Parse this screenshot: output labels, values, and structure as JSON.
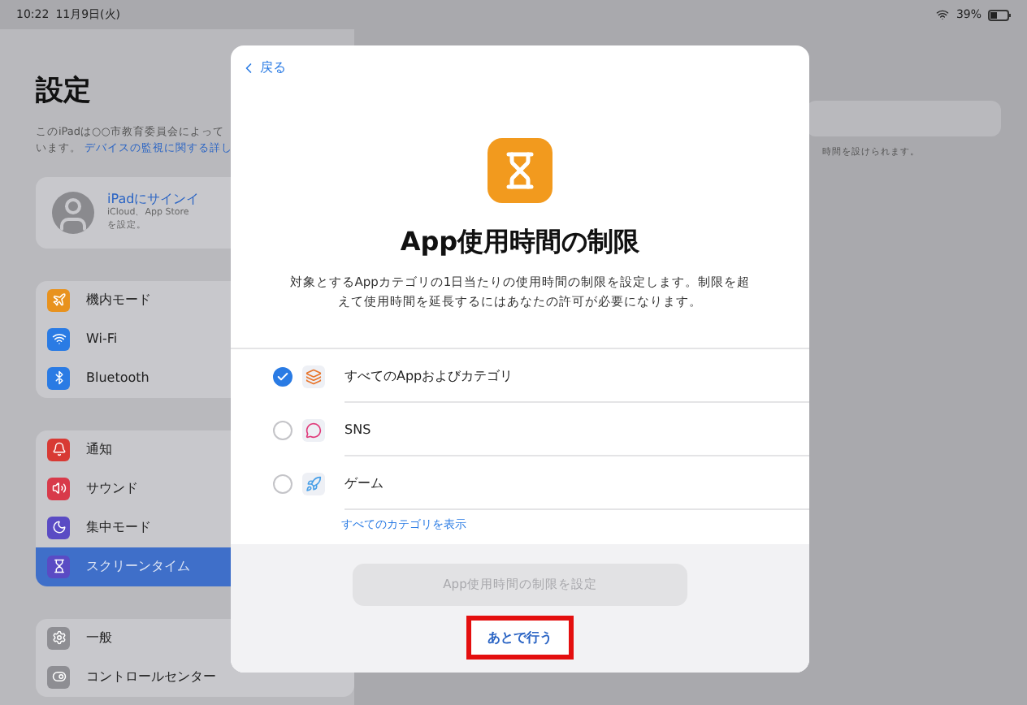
{
  "status_bar": {
    "time": "10:22",
    "date": "11月9日(火)",
    "battery": "39%"
  },
  "sidebar": {
    "title": "設定",
    "notice": "このiPadは○○市教育委員会によって",
    "notice_line2": "います。",
    "notice_link": "デバイスの監視に関する詳し",
    "account": {
      "title": "iPadにサインイ",
      "subtitle": "iCloud、App Store",
      "subtitle2": "を設定。"
    },
    "groups": [
      [
        {
          "label": "機内モード",
          "color": "#e8921e",
          "selected": false
        },
        {
          "label": "Wi-Fi",
          "color": "#2a7be4",
          "selected": false
        },
        {
          "label": "Bluetooth",
          "color": "#2a7be4",
          "selected": false
        }
      ],
      [
        {
          "label": "通知",
          "color": "#d83a34",
          "selected": false
        },
        {
          "label": "サウンド",
          "color": "#d83a4a",
          "selected": false
        },
        {
          "label": "集中モード",
          "color": "#5a4bc4",
          "selected": false
        },
        {
          "label": "スクリーンタイム",
          "color": "#5a4bc4",
          "selected": true
        }
      ],
      [
        {
          "label": "一般",
          "color": "#8e8e93",
          "selected": false
        },
        {
          "label": "コントロールセンター",
          "color": "#8e8e93",
          "selected": false
        }
      ]
    ]
  },
  "detail": {
    "caption": "時間を設けられます。"
  },
  "dialog": {
    "back": "戻る",
    "title": "App使用時間の制限",
    "description": "対象とするAppカテゴリの1日当たりの使用時間の制限を設定します。制限を超えて使用時間を延長するにはあなたの許可が必要になります。",
    "categories": [
      {
        "label": "すべてのAppおよびカテゴリ",
        "checked": true
      },
      {
        "label": "SNS",
        "checked": false
      },
      {
        "label": "ゲーム",
        "checked": false
      }
    ],
    "show_all": "すべてのカテゴリを表示",
    "primary_button": {
      "label": "App使用時間の制限を設定",
      "disabled": true
    },
    "later_button": "あとで行う"
  }
}
